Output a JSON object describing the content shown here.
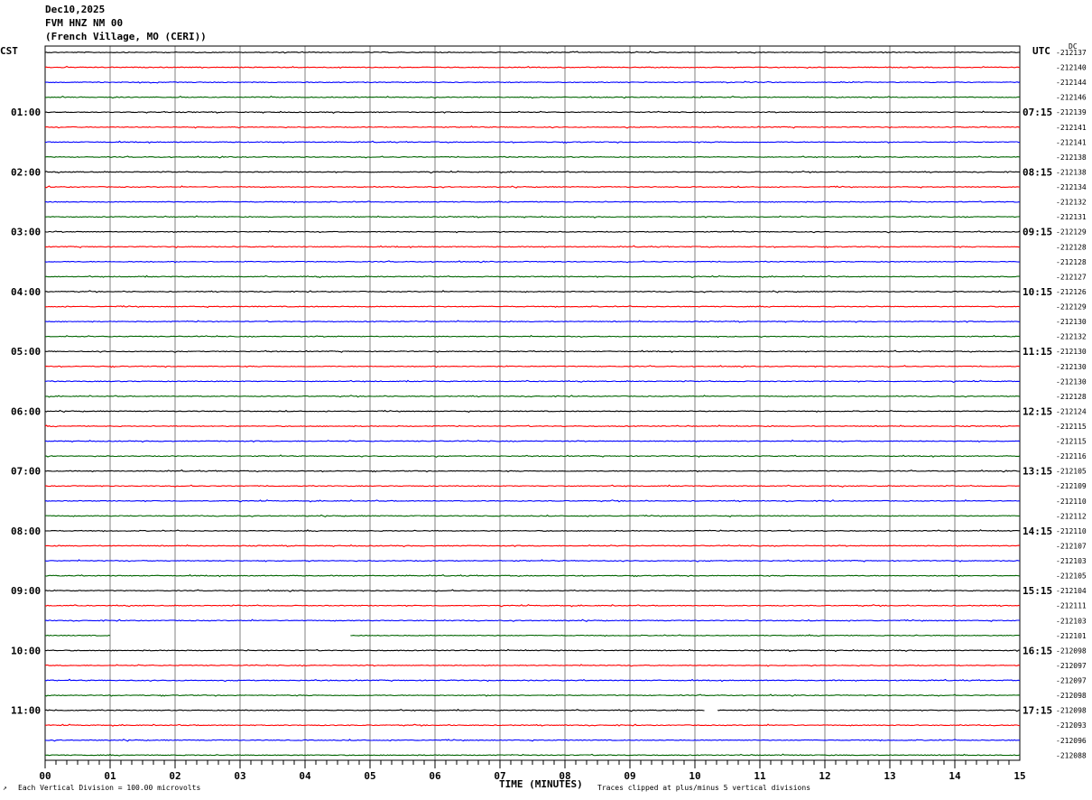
{
  "header": {
    "date": "Dec10,2025",
    "station": "FVM HNZ NM 00",
    "location": "(French Village, MO (CERI))"
  },
  "labels": {
    "left_timezone": "CST",
    "right_timezone": "UTC",
    "dc_label": "DC",
    "xlabel": "TIME (MINUTES)",
    "scale_note": "Each Vertical Division =  100.00 microvolts",
    "clip_note": "Traces clipped at plus/minus 5 vertical divisions"
  },
  "colors": {
    "trace_cycle": [
      "#000000",
      "#ff0000",
      "#0000ff",
      "#006400"
    ],
    "grid": "#808080",
    "background": "#ffffff"
  },
  "chart_data": {
    "type": "line",
    "title": "",
    "xlabel": "TIME (MINUTES)",
    "xlim": [
      0,
      15
    ],
    "x_ticks": [
      "00",
      "01",
      "02",
      "03",
      "04",
      "05",
      "06",
      "07",
      "08",
      "09",
      "10",
      "11",
      "12",
      "13",
      "14",
      "15"
    ],
    "traces_per_hour": 4,
    "cst_hour_labels": [
      "01:00",
      "02:00",
      "03:00",
      "04:00",
      "05:00",
      "06:00",
      "07:00",
      "08:00",
      "09:00",
      "10:00",
      "11:00"
    ],
    "utc_hour_labels": [
      "07:15",
      "08:15",
      "09:15",
      "10:15",
      "11:15",
      "12:15",
      "13:15",
      "14:15",
      "15:15",
      "16:15",
      "17:15"
    ],
    "dc_offsets": [
      "-212137",
      "-212140",
      "-212144",
      "-212146",
      "-212139",
      "-212141",
      "-212141",
      "-212138",
      "-212138",
      "-212134",
      "-212132",
      "-212131",
      "-212129",
      "-212128",
      "-212128",
      "-212127",
      "-212126",
      "-212129",
      "-212130",
      "-212132",
      "-212130",
      "-212130",
      "-212130",
      "-212128",
      "-212124",
      "-212115",
      "-212115",
      "-212116",
      "-212105",
      "-212109",
      "-212110",
      "-212112",
      "-212110",
      "-212107",
      "-212103",
      "-212105",
      "-212104",
      "-212111",
      "-212103",
      "-212101",
      "-212098",
      "-212097",
      "-212097",
      "-212098",
      "-212098",
      "-212093",
      "-212096",
      "-212088"
    ],
    "data_gaps": [
      {
        "trace_index": 39,
        "from_minute": 1.0,
        "to_minute": 4.7
      },
      {
        "trace_index": 44,
        "from_minute": 10.15,
        "to_minute": 10.35
      }
    ]
  }
}
